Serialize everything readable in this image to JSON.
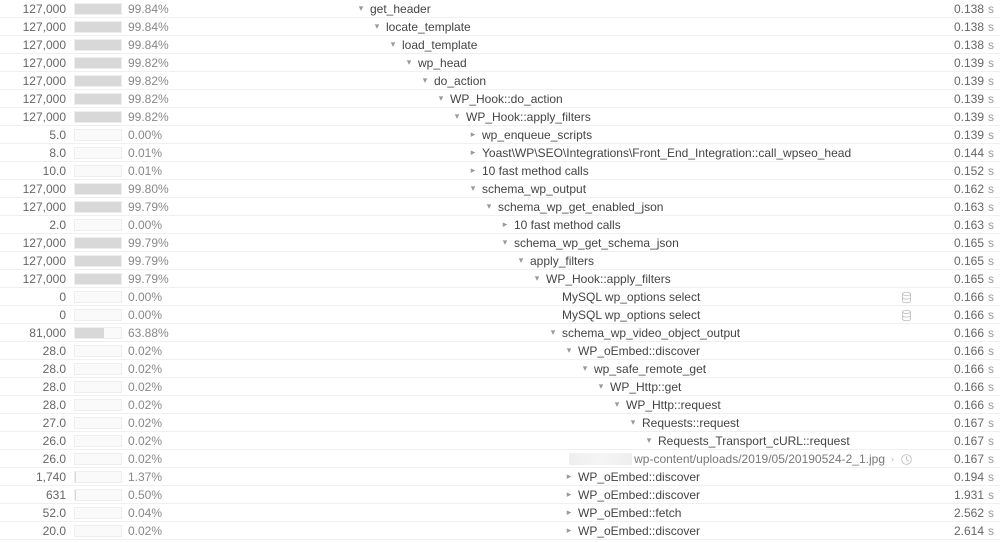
{
  "unit_label": "s",
  "url_visible_part": "wp-content/uploads/2019/05/20190524-2_1.jpg",
  "rows": [
    {
      "value": "127,000",
      "bar": 99.84,
      "pct": "99.84%",
      "indent": 0,
      "open": true,
      "name": "get_header",
      "time": "0.138"
    },
    {
      "value": "127,000",
      "bar": 99.84,
      "pct": "99.84%",
      "indent": 1,
      "open": true,
      "name": "locate_template",
      "time": "0.138"
    },
    {
      "value": "127,000",
      "bar": 99.84,
      "pct": "99.84%",
      "indent": 2,
      "open": true,
      "name": "load_template",
      "time": "0.138"
    },
    {
      "value": "127,000",
      "bar": 99.82,
      "pct": "99.82%",
      "indent": 3,
      "open": true,
      "name": "wp_head",
      "time": "0.139"
    },
    {
      "value": "127,000",
      "bar": 99.82,
      "pct": "99.82%",
      "indent": 4,
      "open": true,
      "name": "do_action",
      "time": "0.139"
    },
    {
      "value": "127,000",
      "bar": 99.82,
      "pct": "99.82%",
      "indent": 5,
      "open": true,
      "name": "WP_Hook::do_action",
      "time": "0.139"
    },
    {
      "value": "127,000",
      "bar": 99.82,
      "pct": "99.82%",
      "indent": 6,
      "open": true,
      "name": "WP_Hook::apply_filters",
      "time": "0.139"
    },
    {
      "value": "5.0",
      "bar": 0,
      "pct": "0.00%",
      "indent": 7,
      "open": false,
      "name": "wp_enqueue_scripts",
      "time": "0.139"
    },
    {
      "value": "8.0",
      "bar": 0.01,
      "pct": "0.01%",
      "indent": 7,
      "open": false,
      "name": "Yoast\\WP\\SEO\\Integrations\\Front_End_Integration::call_wpseo_head",
      "time": "0.144"
    },
    {
      "value": "10.0",
      "bar": 0.01,
      "pct": "0.01%",
      "indent": 7,
      "open": false,
      "name": "10 fast method calls",
      "time": "0.152"
    },
    {
      "value": "127,000",
      "bar": 99.8,
      "pct": "99.80%",
      "indent": 7,
      "open": true,
      "name": "schema_wp_output",
      "time": "0.162"
    },
    {
      "value": "127,000",
      "bar": 99.79,
      "pct": "99.79%",
      "indent": 8,
      "open": true,
      "name": "schema_wp_get_enabled_json",
      "time": "0.163"
    },
    {
      "value": "2.0",
      "bar": 0,
      "pct": "0.00%",
      "indent": 9,
      "open": false,
      "name": "10 fast method calls",
      "time": "0.163"
    },
    {
      "value": "127,000",
      "bar": 99.79,
      "pct": "99.79%",
      "indent": 9,
      "open": true,
      "name": "schema_wp_get_schema_json",
      "time": "0.165"
    },
    {
      "value": "127,000",
      "bar": 99.79,
      "pct": "99.79%",
      "indent": 10,
      "open": true,
      "name": "apply_filters",
      "time": "0.165"
    },
    {
      "value": "127,000",
      "bar": 99.79,
      "pct": "99.79%",
      "indent": 11,
      "open": true,
      "name": "WP_Hook::apply_filters",
      "time": "0.165"
    },
    {
      "value": "0",
      "bar": 0,
      "pct": "0.00%",
      "indent": 12,
      "open": null,
      "name": "MySQL wp_options select",
      "icon": "db",
      "time": "0.166"
    },
    {
      "value": "0",
      "bar": 0,
      "pct": "0.00%",
      "indent": 12,
      "open": null,
      "name": "MySQL wp_options select",
      "icon": "db",
      "time": "0.166"
    },
    {
      "value": "81,000",
      "bar": 63.88,
      "pct": "63.88%",
      "indent": 12,
      "open": true,
      "name": "schema_wp_video_object_output",
      "time": "0.166"
    },
    {
      "value": "28.0",
      "bar": 0.02,
      "pct": "0.02%",
      "indent": 13,
      "open": true,
      "name": "WP_oEmbed::discover",
      "time": "0.166"
    },
    {
      "value": "28.0",
      "bar": 0.02,
      "pct": "0.02%",
      "indent": 14,
      "open": true,
      "name": "wp_safe_remote_get",
      "time": "0.166"
    },
    {
      "value": "28.0",
      "bar": 0.02,
      "pct": "0.02%",
      "indent": 15,
      "open": true,
      "name": "WP_Http::get",
      "time": "0.166"
    },
    {
      "value": "28.0",
      "bar": 0.02,
      "pct": "0.02%",
      "indent": 16,
      "open": true,
      "name": "WP_Http::request",
      "time": "0.166"
    },
    {
      "value": "27.0",
      "bar": 0.02,
      "pct": "0.02%",
      "indent": 17,
      "open": true,
      "name": "Requests::request",
      "time": "0.167"
    },
    {
      "value": "26.0",
      "bar": 0.02,
      "pct": "0.02%",
      "indent": 18,
      "open": true,
      "name": "Requests_Transport_cURL::request",
      "time": "0.167"
    },
    {
      "value": "26.0",
      "bar": 0.02,
      "pct": "0.02%",
      "indent": 19,
      "open": null,
      "name": "__URL__",
      "icon": "clock",
      "time": "0.167"
    },
    {
      "value": "1,740",
      "bar": 1.37,
      "pct": "1.37%",
      "indent": 13,
      "open": false,
      "name": "WP_oEmbed::discover",
      "time": "0.194"
    },
    {
      "value": "631",
      "bar": 0.5,
      "pct": "0.50%",
      "indent": 13,
      "open": false,
      "name": "WP_oEmbed::discover",
      "time": "1.931"
    },
    {
      "value": "52.0",
      "bar": 0.04,
      "pct": "0.04%",
      "indent": 13,
      "open": false,
      "name": "WP_oEmbed::fetch",
      "time": "2.562"
    },
    {
      "value": "20.0",
      "bar": 0.02,
      "pct": "0.02%",
      "indent": 13,
      "open": false,
      "name": "WP_oEmbed::discover",
      "time": "2.614"
    }
  ]
}
